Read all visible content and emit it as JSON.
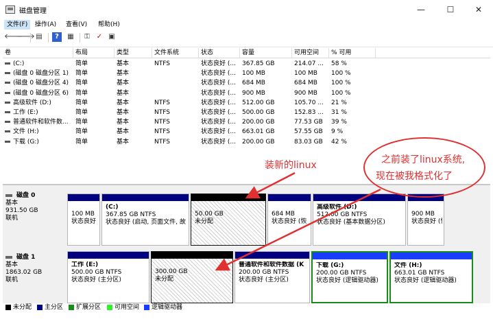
{
  "window": {
    "title": "磁盘管理",
    "minimize": "—",
    "maximize": "☐",
    "close": "✕"
  },
  "menu": [
    {
      "label": "文件(F)",
      "active": true
    },
    {
      "label": "操作(A)"
    },
    {
      "label": "查看(V)"
    },
    {
      "label": "帮助(H)"
    }
  ],
  "toolbar": {
    "back": "🡐",
    "forward": "🡒",
    "panel": "▤",
    "help": "?",
    "view": "▦",
    "key": "⚿",
    "check": "✓",
    "props": "▣"
  },
  "columns": [
    "卷",
    "布局",
    "类型",
    "文件系统",
    "状态",
    "容量",
    "可用空间",
    "% 可用"
  ],
  "volumes": [
    {
      "name": "(C:)",
      "layout": "简单",
      "type": "基本",
      "fs": "NTFS",
      "status": "状态良好 (...",
      "cap": "367.85 GB",
      "free": "214.07 ...",
      "pct": "58 %"
    },
    {
      "name": "(磁盘 0 磁盘分区 1)",
      "layout": "简单",
      "type": "基本",
      "fs": "",
      "status": "状态良好 (...",
      "cap": "100 MB",
      "free": "100 MB",
      "pct": "100 %"
    },
    {
      "name": "(磁盘 0 磁盘分区 4)",
      "layout": "简单",
      "type": "基本",
      "fs": "",
      "status": "状态良好 (...",
      "cap": "684 MB",
      "free": "684 MB",
      "pct": "100 %"
    },
    {
      "name": "(磁盘 0 磁盘分区 6)",
      "layout": "简单",
      "type": "基本",
      "fs": "",
      "status": "状态良好 (...",
      "cap": "900 MB",
      "free": "900 MB",
      "pct": "100 %"
    },
    {
      "name": "高级软件 (D:)",
      "layout": "简单",
      "type": "基本",
      "fs": "NTFS",
      "status": "状态良好 (...",
      "cap": "512.00 GB",
      "free": "105.70 ...",
      "pct": "21 %"
    },
    {
      "name": "工作 (E:)",
      "layout": "简单",
      "type": "基本",
      "fs": "NTFS",
      "status": "状态良好 (...",
      "cap": "500.00 GB",
      "free": "152.83 ...",
      "pct": "31 %"
    },
    {
      "name": "普通软件和软件数...",
      "layout": "简单",
      "type": "基本",
      "fs": "NTFS",
      "status": "状态良好 (...",
      "cap": "200.00 GB",
      "free": "77.53 GB",
      "pct": "39 %"
    },
    {
      "name": "文件 (H:)",
      "layout": "简单",
      "type": "基本",
      "fs": "NTFS",
      "status": "状态良好 (...",
      "cap": "663.01 GB",
      "free": "57.55 GB",
      "pct": "9 %"
    },
    {
      "name": "下载 (G:)",
      "layout": "简单",
      "type": "基本",
      "fs": "NTFS",
      "status": "状态良好 (...",
      "cap": "200.00 GB",
      "free": "83.03 GB",
      "pct": "42 %"
    }
  ],
  "disks": [
    {
      "name": "磁盘 0",
      "kind": "基本",
      "size": "931.50 GB",
      "state": "联机",
      "partitions": [
        {
          "name": "",
          "l1": "100 MB",
          "l2": "状态良好",
          "style": "primary"
        },
        {
          "name": "(C:)",
          "l1": "367.85 GB NTFS",
          "l2": "状态良好 (启动, 页面文件, 故",
          "style": "primary"
        },
        {
          "name": "",
          "l1": "50.00 GB",
          "l2": "未分配",
          "style": "unallocated"
        },
        {
          "name": "",
          "l1": "684 MB",
          "l2": "状态良好 (恢",
          "style": "primary"
        },
        {
          "name": "高级软件 (D:)",
          "l1": "512.00 GB NTFS",
          "l2": "状态良好 (基本数据分区)",
          "style": "primary"
        },
        {
          "name": "",
          "l1": "900 MB",
          "l2": "状态良好 (恢",
          "style": "primary"
        }
      ]
    },
    {
      "name": "磁盘 1",
      "kind": "基本",
      "size": "1863.02 GB",
      "state": "联机",
      "partitions": [
        {
          "name": "工作 (E:)",
          "l1": "500.00 GB NTFS",
          "l2": "状态良好 (主分区)",
          "style": "primary"
        },
        {
          "name": "",
          "l1": "300.00 GB",
          "l2": "未分配",
          "style": "unallocated"
        },
        {
          "name": "普通软件和软件数据 (K",
          "l1": "200.00 GB NTFS",
          "l2": "状态良好 (主分区)",
          "style": "primary"
        },
        {
          "name": "下载 (G:)",
          "l1": "200.00 GB NTFS",
          "l2": "状态良好 (逻辑驱动器)",
          "style": "logical"
        },
        {
          "name": "文件 (H:)",
          "l1": "663.01 GB NTFS",
          "l2": "状态良好 (逻辑驱动器)",
          "style": "logical"
        }
      ]
    }
  ],
  "legend": [
    {
      "label": "未分配",
      "color": "#000000"
    },
    {
      "label": "主分区",
      "color": "#000080"
    },
    {
      "label": "扩展分区",
      "color": "#1a8a1a"
    },
    {
      "label": "可用空间",
      "color": "#33ee33"
    },
    {
      "label": "逻辑驱动器",
      "color": "#1a3cff"
    }
  ],
  "annotations": {
    "new_linux": "装新的linux",
    "old_line1": "之前装了linux系统,",
    "old_line2": "现在被我格式化了"
  },
  "colors": {
    "primary": "#000080",
    "logical": "#1a3cff",
    "unallocated": "#000000",
    "annotation": "#e03030"
  }
}
